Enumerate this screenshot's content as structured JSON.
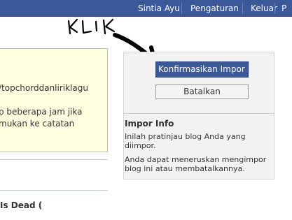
{
  "topnav": {
    "items": [
      "Sintia Ayu",
      "Pengaturan",
      "Keluar",
      "P"
    ]
  },
  "annotation": {
    "text": "KLIK"
  },
  "notice": {
    "lines": [
      "/topchorddanliriklagu",
      "p beberapa jam jika",
      "mukan ke catatan"
    ]
  },
  "post": {
    "title": "Is Dead ("
  },
  "import_panel": {
    "confirm_label": "Konfirmasikan Impor",
    "cancel_label": "Batalkan",
    "title": "Impor Info",
    "text1": "Inilah pratinjau blog Anda yang diimpor.",
    "text2": "Anda dapat meneruskan mengimpor blog ini atau membatalkannya."
  },
  "colors": {
    "topbar": "#3b5998",
    "confirm_button": "#3b5998",
    "notice_background": "#ffffdf",
    "notice_border": "#e2c822",
    "panel_background": "#f2f2f2"
  }
}
